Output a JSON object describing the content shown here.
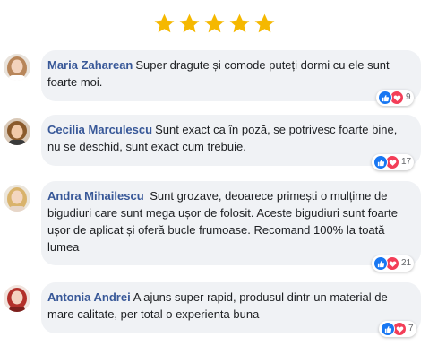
{
  "rating": {
    "stars": 5,
    "max": 5,
    "color": "#f5b800"
  },
  "comments": [
    {
      "author": "Maria Zaharean",
      "text": "Super dragute și comode puteți dormi cu ele sunt foarte moi.",
      "reaction_count": "9"
    },
    {
      "author": "Cecilia Marculescu",
      "text": "Sunt exact ca în poză, se potrivesc foarte bine, nu se deschid, sunt exact cum trebuie.",
      "reaction_count": "17"
    },
    {
      "author": "Andra Mihailescu",
      "text": " Sunt grozave, deoarece primești o mulțime de bigudiuri care sunt mega ușor de folosit. Aceste bigudiuri sunt foarte ușor de aplicat și oferă bucle frumoase.  Recomand 100% la toată lumea",
      "reaction_count": "21"
    },
    {
      "author": "Antonia Andrei",
      "text": "A ajuns super rapid, produsul dintr-un material de mare calitate, per total o experienta buna",
      "reaction_count": "7"
    }
  ],
  "colors": {
    "author": "#385898",
    "bubble": "#f0f2f5",
    "like": "#1877f2",
    "love": "#f33e58"
  },
  "icons": [
    "star-icon",
    "like-icon",
    "love-icon"
  ]
}
